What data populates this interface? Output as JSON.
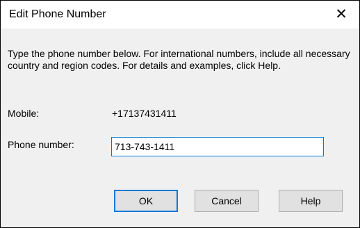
{
  "dialog": {
    "title": "Edit Phone Number",
    "close_glyph": "✕",
    "instructions": "Type the phone number below. For international numbers, include all necessary country and region codes. For details and examples, click Help.",
    "mobile_label": "Mobile:",
    "mobile_value": "+17137431411",
    "phone_label": "Phone number:",
    "phone_value": "713-743-1411",
    "buttons": {
      "ok": "OK",
      "cancel": "Cancel",
      "help": "Help"
    }
  },
  "colors": {
    "accent": "#0078d7",
    "client_background": "#f0f0f0",
    "button_face": "#e1e1e1"
  },
  "icons": {
    "close": "close-icon"
  }
}
